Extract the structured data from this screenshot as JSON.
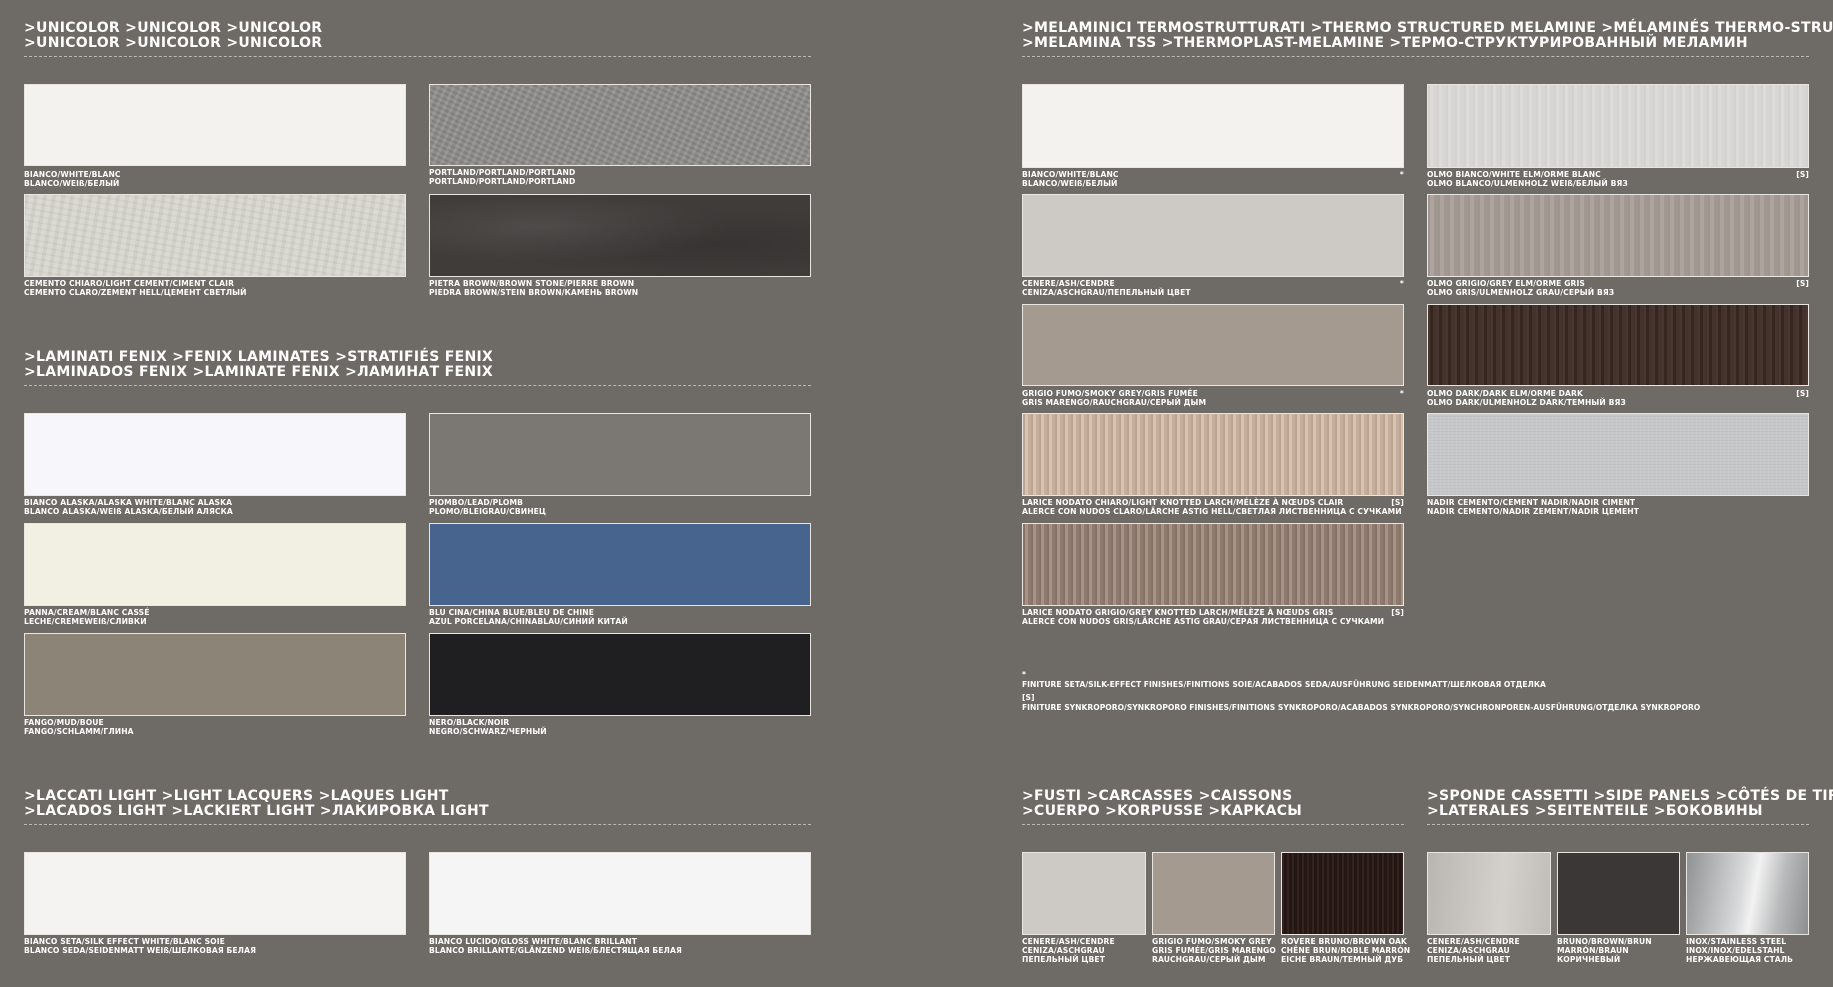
{
  "unicolor": {
    "title": [
      ">UNICOLOR >UNICOLOR >UNICOLOR",
      ">UNICOLOR >UNICOLOR >UNICOLOR"
    ],
    "swatches": [
      {
        "l1": "BIANCO/WHITE/BLANC",
        "l2": "BLANCO/WEIß/БЕЛЫЙ",
        "texture": "white"
      },
      {
        "l1": "PORTLAND/PORTLAND/PORTLAND",
        "l2": "PORTLAND/PORTLAND/PORTLAND",
        "texture": "portland"
      },
      {
        "l1": "CEMENTO CHIARO/LIGHT CEMENT/CIMENT CLAIR",
        "l2": "CEMENTO CLARO/ZEMENT HELL/ЦЕМЕНТ СВЕТЛЫЙ",
        "texture": "cement"
      },
      {
        "l1": "PIETRA BROWN/BROWN STONE/PIERRE BROWN",
        "l2": "PIEDRA BROWN/STEIN BROWN/КАМЕНЬ BROWN",
        "texture": "stone"
      }
    ]
  },
  "fenix": {
    "title": [
      ">LAMINATI FENIX >FENIX LAMINATES >STRATIFIÉS FENIX",
      ">LAMINADOS FENIX >LAMINATE FENIX >ЛАМИНАТ FENIX"
    ],
    "swatches": [
      {
        "l1": "BIANCO ALASKA/ALASKA WHITE/BLANC ALASKA",
        "l2": "BLANCO ALASKA/WEIß ALASKA/БЕЛЫЙ АЛЯСКА",
        "texture": "alaska"
      },
      {
        "l1": "PIOMBO/LEAD/PLOMB",
        "l2": "PLOMO/BLEIGRAU/СВИНЕЦ",
        "texture": "lead"
      },
      {
        "l1": "PANNA/CREAM/BLANC CASSÉ",
        "l2": "LECHE/CREMEWEIß/СЛИВКИ",
        "texture": "cream"
      },
      {
        "l1": "BLU CINA/CHINA BLUE/BLEU DE CHINE",
        "l2": "AZUL PORCELANA/CHINABLAU/СИНИЙ КИТАЙ",
        "texture": "blue"
      },
      {
        "l1": "FANGO/MUD/BOUE",
        "l2": "FANGO/SCHLAMM/ГЛИНА",
        "texture": "mud"
      },
      {
        "l1": "NERO/BLACK/NOIR",
        "l2": "NEGRO/SCHWARZ/ЧЕРНЫЙ",
        "texture": "black"
      }
    ]
  },
  "lacquers": {
    "title": [
      ">LACCATI LIGHT >LIGHT LACQUERS >LAQUES LIGHT",
      ">LACADOS LIGHT >LACKIERT LIGHT >ЛАКИРОВКА LIGHT"
    ],
    "swatches": [
      {
        "l1": "BIANCO SETA/SILK EFFECT WHITE/BLANC SOIE",
        "l2": "BLANCO SEDA/SEIDENMATT WEIß/ШЕЛКОВАЯ БЕЛАЯ",
        "texture": "silk"
      },
      {
        "l1": "BIANCO LUCIDO/GLOSS WHITE/BLANC BRILLANT",
        "l2": "BLANCO BRILLANTE/GLÄNZEND WEIß/БЛЕСТЯЩАЯ БЕЛАЯ",
        "texture": "gloss"
      }
    ]
  },
  "melamine": {
    "title": [
      ">MELAMINICI TERMOSTRUTTURATI >THERMO STRUCTURED MELAMINE >MÉLAMINÉS THERMO-STRUCTURÉS",
      ">MELAMINA TSS >THERMOPLAST-MELAMINE >ТЕРМО-СТРУКТУРИРОВАННЫЙ МЕЛАМИН"
    ],
    "swatches": [
      {
        "l1": "BIANCO/WHITE/BLANC",
        "l2": "BLANCO/WEIß/БЕЛЫЙ",
        "mark": "*",
        "texture": "white"
      },
      {
        "l1": "OLMO BIANCO/WHITE ELM/ORME BLANC",
        "l2": "OLMO BLANCO/ULMENHOLZ WEIß/БЕЛЫЙ ВЯЗ",
        "mark": "[S]",
        "texture": "whiteelm"
      },
      {
        "l1": "CENERE/ASH/CENDRE",
        "l2": "CENIZA/ASCHGRAU/ПЕПЕЛЬНЫЙ ЦВЕТ",
        "mark": "*",
        "texture": "ash"
      },
      {
        "l1": "OLMO GRIGIO/GREY ELM/ORME GRIS",
        "l2": "OLMO GRIS/ULMENHOLZ GRAU/СЕРЫЙ ВЯЗ",
        "mark": "[S]",
        "texture": "greyelm"
      },
      {
        "l1": "GRIGIO FUMO/SMOKY GREY/GRIS FUMÉE",
        "l2": "GRIS MARENGO/RAUCHGRAU/СЕРЫЙ ДЫМ",
        "mark": "*",
        "texture": "smoky"
      },
      {
        "l1": "OLMO DARK/DARK ELM/ORME DARK",
        "l2": "OLMO DARK/ULMENHOLZ DARK/ТЕМНЫЙ ВЯЗ",
        "mark": "[S]",
        "texture": "darkelm"
      },
      {
        "l1": "LARICE NODATO CHIARO/LIGHT KNOTTED LARCH/MÉLÈZE À NŒUDS CLAIR",
        "l2": "ALERCE CON NUDOS CLARO/LÄRCHE ASTIG HELL/СВЕТЛАЯ ЛИСТВЕННИЦА С СУЧКАМИ",
        "mark": "[S]",
        "texture": "lightlarch"
      },
      {
        "l1": "NADIR CEMENTO/CEMENT NADIR/NADIR CIMENT",
        "l2": "NADIR CEMENTO/NADIR ZEMENT/NADIR ЦЕМЕНТ",
        "mark": "",
        "texture": "nadir"
      },
      {
        "l1": "LARICE NODATO GRIGIO/GREY KNOTTED LARCH/MÉLÈZE À NŒUDS GRIS",
        "l2": "ALERCE CON NUDOS GRIS/LÄRCHE ASTIG GRAU/СЕРАЯ ЛИСТВЕННИЦА С СУЧКАМИ",
        "mark": "[S]",
        "texture": "greylarch"
      }
    ],
    "notes": {
      "star_symbol": "*",
      "star_text": "FINITURE SETA/SILK-EFFECT FINISHES/FINITIONS SOIE/ACABADOS SEDA/AUSFÜHRUNG SEIDENMATT/ШЕЛКОВАЯ ОТДЕЛКА",
      "s_symbol": "[S]",
      "s_text": "FINITURE SYNKROPORO/SYNKROPORO FINISHES/FINITIONS SYNKROPORO/ACABADOS SYNKROPORO/SYNCHRONPOREN-AUSFÜHRUNG/ОТДЕЛКА SYNKROPORO"
    }
  },
  "carcasses": {
    "title": [
      ">FUSTI >CARCASSES >CAISSONS",
      ">CUERPO >KORPUSSE >КАРКАСЫ"
    ],
    "swatches": [
      {
        "lines": [
          "CENERE/ASH/CENDRE",
          "CENIZA/ASCHGRAU",
          "ПЕПЕЛЬНЫЙ ЦВЕТ"
        ],
        "texture": "ash"
      },
      {
        "lines": [
          "GRIGIO FUMO/SMOKY GREY",
          "GRIS FUMÉE/GRIS MARENGO",
          "RAUCHGRAU/СЕРЫЙ ДЫМ"
        ],
        "texture": "smoky"
      },
      {
        "lines": [
          "ROVERE BRUNO/BROWN OAK",
          "CHÊNE BRUN/ROBLE MARRÓN",
          "EICHE BRAUN/ТЕМНЫЙ ДУБ"
        ],
        "texture": "brownoak"
      }
    ]
  },
  "side_panels": {
    "title": [
      ">SPONDE CASSETTI >SIDE PANELS >CÔTÉS DE TIROIR",
      ">LATERALES >SEITENTEILE >БОКОВИНЫ"
    ],
    "swatches": [
      {
        "lines": [
          "CENERE/ASH/CENDRE",
          "CENIZA/ASCHGRAU",
          "ПЕПЕЛЬНЫЙ ЦВЕТ"
        ],
        "texture": "ash-s"
      },
      {
        "lines": [
          "BRUNO/BROWN/BRUN",
          "MARRÓN/BRAUN",
          "КОРИЧНЕВЫЙ"
        ],
        "texture": "brown"
      },
      {
        "lines": [
          "INOX/STAINLESS STEEL",
          "INOX/INOX/EDELSTAHL",
          "НЕРЖАВЕЮЩАЯ СТАЛЬ"
        ],
        "texture": "steel"
      }
    ]
  }
}
